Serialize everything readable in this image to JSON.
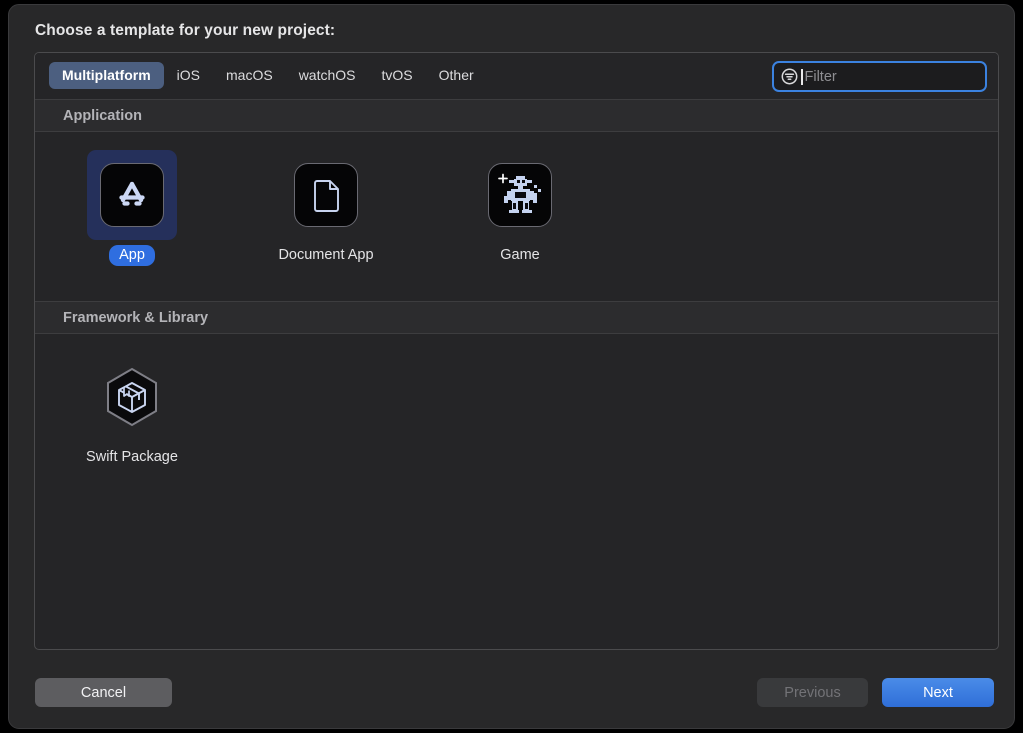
{
  "dialog": {
    "prompt": "Choose a template for your new project:"
  },
  "tabs": [
    {
      "label": "Multiplatform",
      "selected": true
    },
    {
      "label": "iOS",
      "selected": false
    },
    {
      "label": "macOS",
      "selected": false
    },
    {
      "label": "watchOS",
      "selected": false
    },
    {
      "label": "tvOS",
      "selected": false
    },
    {
      "label": "Other",
      "selected": false
    }
  ],
  "filter": {
    "placeholder": "Filter",
    "value": "",
    "icon": "filter-icon",
    "focused": true
  },
  "sections": [
    {
      "title": "Application",
      "items": [
        {
          "label": "App",
          "icon": "app-store-icon",
          "selected": true
        },
        {
          "label": "Document App",
          "icon": "document-icon",
          "selected": false
        },
        {
          "label": "Game",
          "icon": "game-robot-icon",
          "selected": false
        }
      ]
    },
    {
      "title": "Framework & Library",
      "items": [
        {
          "label": "Swift Package",
          "icon": "swift-package-icon",
          "selected": false
        }
      ]
    }
  ],
  "buttons": {
    "cancel": "Cancel",
    "previous": "Previous",
    "next": "Next"
  },
  "colors": {
    "accent": "#2f6ee0",
    "selected_tab": "#4c5f80",
    "focus_ring": "#3b82e0",
    "selection_backdrop": "#25305b",
    "window_bg": "#282829",
    "panel_bg": "#252527"
  }
}
